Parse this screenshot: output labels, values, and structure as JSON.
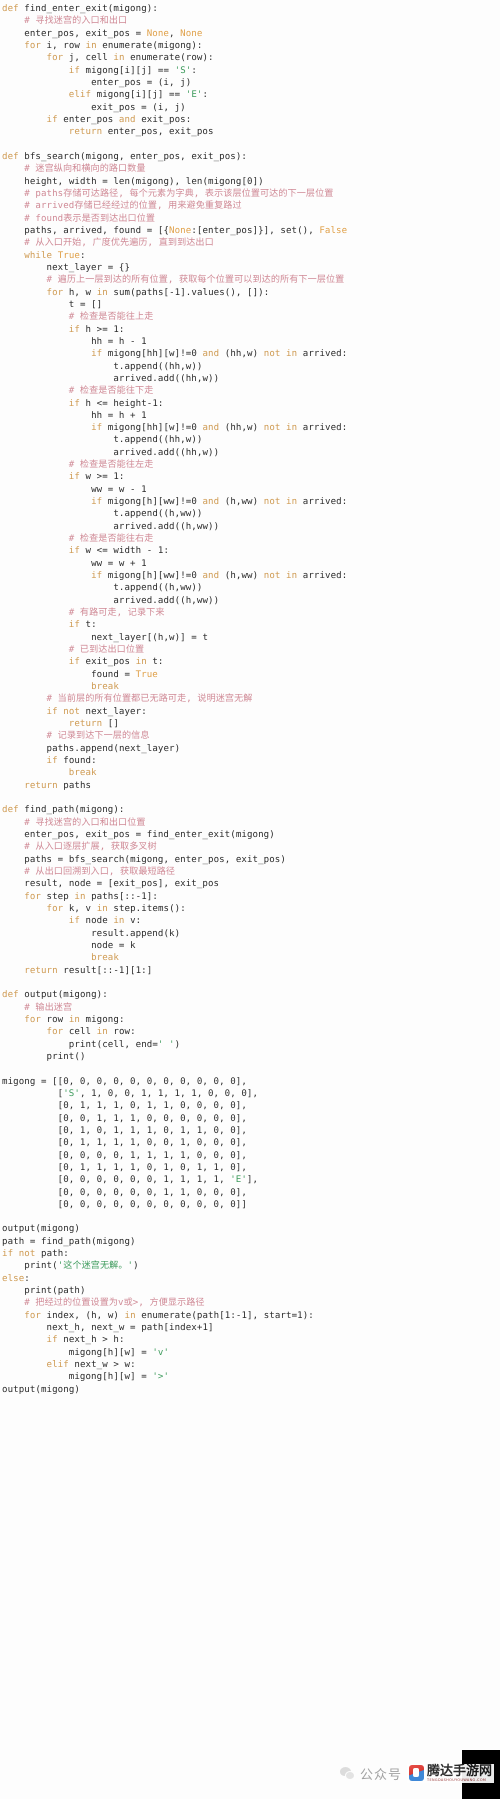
{
  "document": {
    "type": "python-source-code-screenshot",
    "language": "Python",
    "background_color": "#fdfdfd",
    "syntax_colors": {
      "keyword": "#cf9b53",
      "builtin_constant": "#e0a14a",
      "string": "#3d9b5c",
      "comment": "#d08a96",
      "plain": "#2b2b2b"
    }
  },
  "watermark": {
    "wechat_icon": "wechat-icon",
    "gongzhonghao_label": "公众号",
    "site_name": "腾达手游网",
    "site_sub_label": "TENGDASHOUYOUWANG.COM"
  },
  "code": {
    "lines": [
      "def find_enter_exit(migong):",
      "    # 寻找迷宫的入口和出口",
      "    enter_pos, exit_pos = None, None",
      "    for i, row in enumerate(migong):",
      "        for j, cell in enumerate(row):",
      "            if migong[i][j] == 'S':",
      "                enter_pos = (i, j)",
      "            elif migong[i][j] == 'E':",
      "                exit_pos = (i, j)",
      "        if enter_pos and exit_pos:",
      "            return enter_pos, exit_pos",
      "",
      "def bfs_search(migong, enter_pos, exit_pos):",
      "    # 迷宫纵向和横向的路口数量",
      "    height, width = len(migong), len(migong[0])",
      "    # paths存储可达路径, 每个元素为字典, 表示该层位置可达的下一层位置",
      "    # arrived存储已经经过的位置, 用来避免重复路过",
      "    # found表示是否到达出口位置",
      "    paths, arrived, found = [{None:[enter_pos]}], set(), False",
      "    # 从入口开始, 广度优先遍历, 直到到达出口",
      "    while True:",
      "        next_layer = {}",
      "        # 遍历上一层到达的所有位置, 获取每个位置可以到达的所有下一层位置",
      "        for h, w in sum(paths[-1].values(), []):",
      "            t = []",
      "            # 检查是否能往上走",
      "            if h >= 1:",
      "                hh = h - 1",
      "                if migong[hh][w]!=0 and (hh,w) not in arrived:",
      "                    t.append((hh,w))",
      "                    arrived.add((hh,w))",
      "            # 检查是否能往下走",
      "            if h <= height-1:",
      "                hh = h + 1",
      "                if migong[hh][w]!=0 and (hh,w) not in arrived:",
      "                    t.append((hh,w))",
      "                    arrived.add((hh,w))",
      "            # 检查是否能往左走",
      "            if w >= 1:",
      "                ww = w - 1",
      "                if migong[h][ww]!=0 and (h,ww) not in arrived:",
      "                    t.append((h,ww))",
      "                    arrived.add((h,ww))",
      "            # 检查是否能往右走",
      "            if w <= width - 1:",
      "                ww = w + 1",
      "                if migong[h][ww]!=0 and (h,ww) not in arrived:",
      "                    t.append((h,ww))",
      "                    arrived.add((h,ww))",
      "            # 有路可走, 记录下来",
      "            if t:",
      "                next_layer[(h,w)] = t",
      "            # 已到达出口位置",
      "            if exit_pos in t:",
      "                found = True",
      "                break",
      "        # 当前层的所有位置都已无路可走, 说明迷宫无解",
      "        if not next_layer:",
      "            return []",
      "        # 记录到达下一层的信息",
      "        paths.append(next_layer)",
      "        if found:",
      "            break",
      "    return paths",
      "",
      "def find_path(migong):",
      "    # 寻找迷宫的入口和出口位置",
      "    enter_pos, exit_pos = find_enter_exit(migong)",
      "    # 从入口逐层扩展, 获取多叉树",
      "    paths = bfs_search(migong, enter_pos, exit_pos)",
      "    # 从出口回溯到入口, 获取最短路径",
      "    result, node = [exit_pos], exit_pos",
      "    for step in paths[::-1]:",
      "        for k, v in step.items():",
      "            if node in v:",
      "                result.append(k)",
      "                node = k",
      "                break",
      "    return result[::-1][1:]",
      "",
      "def output(migong):",
      "    # 输出迷宫",
      "    for row in migong:",
      "        for cell in row:",
      "            print(cell, end=' ')",
      "        print()",
      "",
      "migong = [[0, 0, 0, 0, 0, 0, 0, 0, 0, 0, 0],",
      "          ['S', 1, 0, 0, 1, 1, 1, 1, 0, 0, 0],",
      "          [0, 1, 1, 1, 0, 1, 1, 0, 0, 0, 0],",
      "          [0, 0, 1, 1, 1, 0, 0, 0, 0, 0, 0],",
      "          [0, 1, 0, 1, 1, 1, 0, 1, 1, 0, 0],",
      "          [0, 1, 1, 1, 1, 0, 0, 1, 0, 0, 0],",
      "          [0, 0, 0, 0, 1, 1, 1, 1, 0, 0, 0],",
      "          [0, 1, 1, 1, 1, 0, 1, 0, 1, 1, 0],",
      "          [0, 0, 0, 0, 0, 0, 1, 1, 1, 1, 'E'],",
      "          [0, 0, 0, 0, 0, 0, 1, 1, 0, 0, 0],",
      "          [0, 0, 0, 0, 0, 0, 0, 0, 0, 0, 0]]",
      "",
      "output(migong)",
      "path = find_path(migong)",
      "if not path:",
      "    print('这个迷宫无解。')",
      "else:",
      "    print(path)",
      "    # 把经过的位置设置为v或>, 方便显示路径",
      "    for index, (h, w) in enumerate(path[1:-1], start=1):",
      "        next_h, next_w = path[index+1]",
      "        if next_h > h:",
      "            migong[h][w] = 'v'",
      "        elif next_w > w:",
      "            migong[h][w] = '>'",
      "output(migong)"
    ],
    "maze_matrix": [
      [
        0,
        0,
        0,
        0,
        0,
        0,
        0,
        0,
        0,
        0,
        0
      ],
      [
        "S",
        1,
        0,
        0,
        1,
        1,
        1,
        1,
        0,
        0,
        0
      ],
      [
        0,
        1,
        1,
        1,
        0,
        1,
        1,
        0,
        0,
        0,
        0
      ],
      [
        0,
        0,
        1,
        1,
        1,
        0,
        0,
        0,
        0,
        0,
        0
      ],
      [
        0,
        1,
        0,
        1,
        1,
        1,
        0,
        1,
        1,
        0,
        0
      ],
      [
        0,
        1,
        1,
        1,
        1,
        0,
        0,
        1,
        0,
        0,
        0
      ],
      [
        0,
        0,
        0,
        0,
        1,
        1,
        1,
        1,
        0,
        0,
        0
      ],
      [
        0,
        1,
        1,
        1,
        1,
        0,
        1,
        0,
        1,
        1,
        0
      ],
      [
        0,
        0,
        0,
        0,
        0,
        0,
        1,
        1,
        1,
        1,
        "E"
      ],
      [
        0,
        0,
        0,
        0,
        0,
        0,
        1,
        1,
        0,
        0,
        0
      ],
      [
        0,
        0,
        0,
        0,
        0,
        0,
        0,
        0,
        0,
        0,
        0
      ]
    ],
    "functions": [
      "find_enter_exit",
      "bfs_search",
      "find_path",
      "output"
    ],
    "strings": [
      "'S'",
      "'E'",
      "' '",
      "'这个迷宫无解。'",
      "'v'",
      "'>'"
    ]
  }
}
